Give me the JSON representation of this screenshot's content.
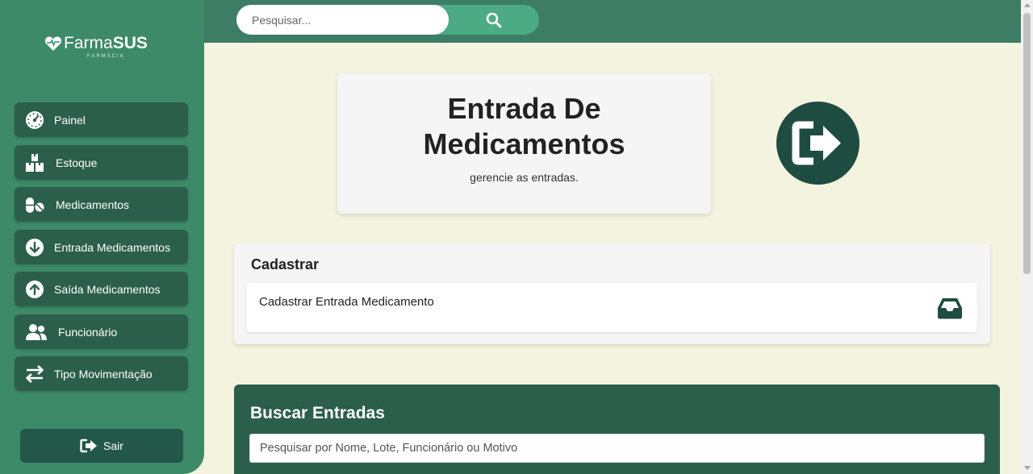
{
  "app": {
    "logo_word_light": "Farma",
    "logo_word_bold": "SUS",
    "logo_sub": "FARMÁCIA"
  },
  "search": {
    "placeholder": "Pesquisar...",
    "icon": "search-icon"
  },
  "sidebar": {
    "items": [
      {
        "label": "Painel",
        "icon": "gauge-icon"
      },
      {
        "label": "Estoque",
        "icon": "boxes-icon"
      },
      {
        "label": "Medicamentos",
        "icon": "pills-icon"
      },
      {
        "label": "Entrada Medicamentos",
        "icon": "arrow-down-circle-icon"
      },
      {
        "label": "Saída Medicamentos",
        "icon": "arrow-up-circle-icon"
      },
      {
        "label": "Funcionário",
        "icon": "users-icon"
      },
      {
        "label": "Tipo Movimentação",
        "icon": "arrows-left-right-icon"
      }
    ],
    "logout_label": "Sair"
  },
  "hero": {
    "title_line1": "Entrada De",
    "title_line2": "Medicamentos",
    "subtitle": "gerencie as entradas.",
    "icon": "sign-in-arrow-icon"
  },
  "cadastrar": {
    "title": "Cadastrar",
    "row_label": "Cadastrar Entrada Medicamento",
    "row_icon": "inbox-tray-icon"
  },
  "buscar": {
    "title": "Buscar Entradas",
    "placeholder": "Pesquisar por Nome, Lote, Funcionário ou Motivo"
  },
  "colors": {
    "sidebar_bg": "#3d8a68",
    "nav_item_bg": "#2c5f4b",
    "topbar_bg": "#3d7d66",
    "search_accent": "#4caa84",
    "page_bg": "#f4f3df",
    "dark_green": "#1f4c40",
    "busca_bg": "#2b5e4b"
  }
}
